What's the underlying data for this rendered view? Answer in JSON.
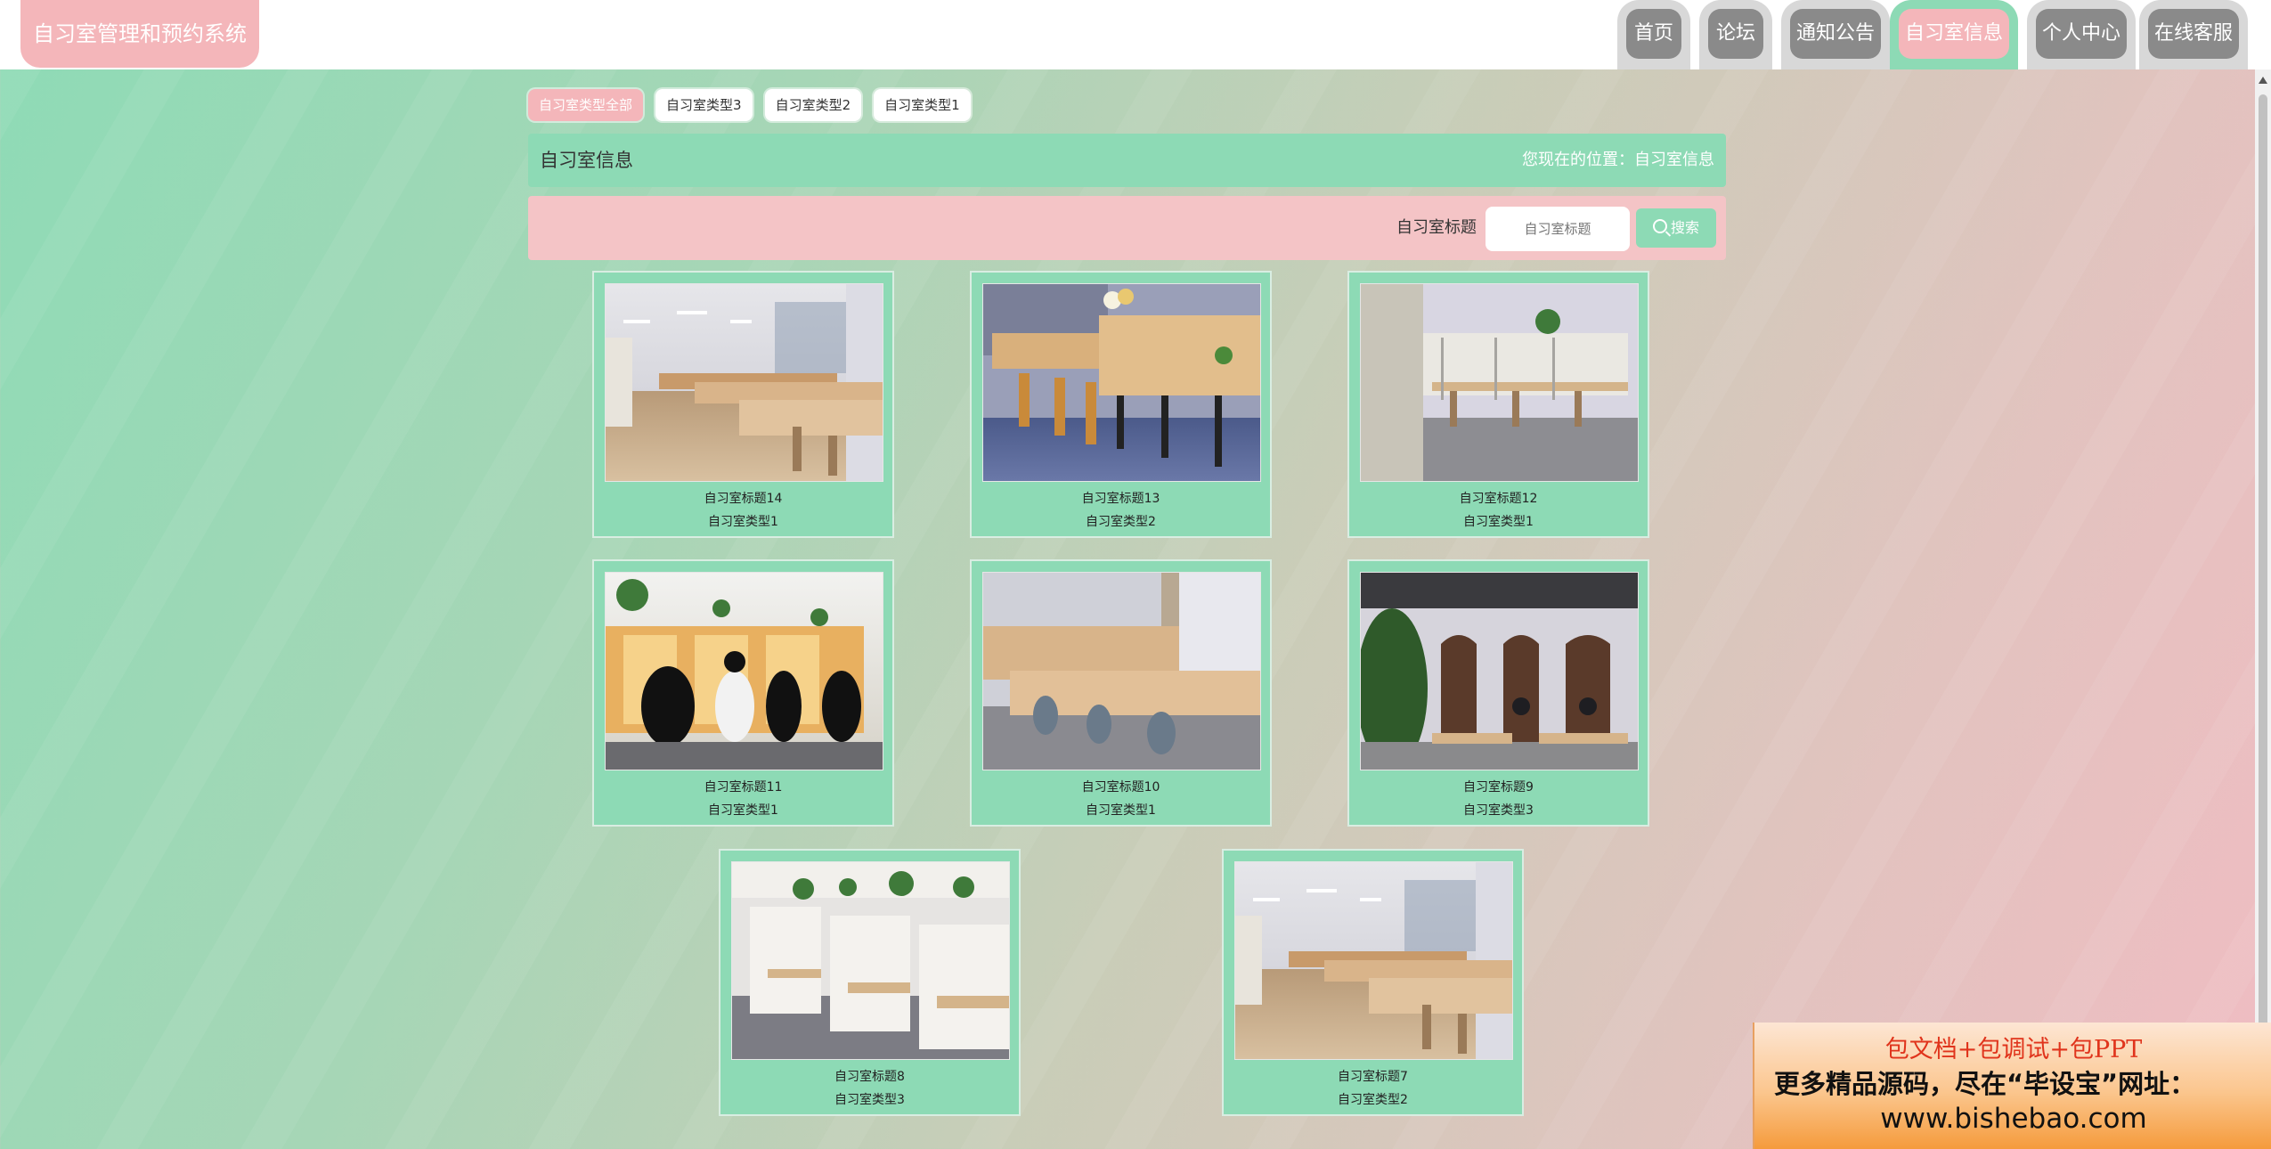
{
  "header": {
    "logo": "自习室管理和预约系统",
    "nav": [
      {
        "label": "首页",
        "active": false
      },
      {
        "label": "论坛",
        "active": false
      },
      {
        "label": "通知公告",
        "active": false
      },
      {
        "label": "自习室信息",
        "active": true
      },
      {
        "label": "个人中心",
        "active": false
      },
      {
        "label": "在线客服",
        "active": false
      }
    ]
  },
  "filters": [
    {
      "label": "自习室类型全部",
      "active": true
    },
    {
      "label": "自习室类型3",
      "active": false
    },
    {
      "label": "自习室类型2",
      "active": false
    },
    {
      "label": "自习室类型1",
      "active": false
    }
  ],
  "titlebar": {
    "title": "自习室信息",
    "location": "您现在的位置：自习室信息"
  },
  "search": {
    "label": "自习室标题",
    "placeholder": "自习室标题",
    "button": "搜索"
  },
  "cards": [
    {
      "title": "自习室标题14",
      "type": "自习室类型1"
    },
    {
      "title": "自习室标题13",
      "type": "自习室类型2"
    },
    {
      "title": "自习室标题12",
      "type": "自习室类型1"
    },
    {
      "title": "自习室标题11",
      "type": "自习室类型1"
    },
    {
      "title": "自习室标题10",
      "type": "自习室类型1"
    },
    {
      "title": "自习室标题9",
      "type": "自习室类型3"
    },
    {
      "title": "自习室标题8",
      "type": "自习室类型3"
    },
    {
      "title": "自习室标题7",
      "type": "自习室类型2"
    }
  ],
  "promo": {
    "line1": "包文档+包调试+包PPT",
    "line2": "更多精品源码，尽在“毕设宝”网址：",
    "line3": "www.bishebao.com"
  },
  "colors": {
    "accent_green": "#8ddab5",
    "accent_pink": "#f4b6ba",
    "nav_gray": "#8a8a8a"
  }
}
